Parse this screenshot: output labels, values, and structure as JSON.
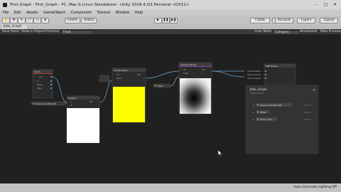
{
  "window": {
    "title": "First Graph - First_Graph - PC, Mac & Linux Standalone - Unity 2018.4.1f1 Personal <DX11>",
    "controls": [
      "–",
      "□",
      "✕"
    ]
  },
  "menu": [
    "File",
    "Edit",
    "Assets",
    "GameObject",
    "Component",
    "Tutorial",
    "Window",
    "Help"
  ],
  "toolbar": {
    "pivot_label": "Center",
    "space_label": "Global",
    "collab_label": "Collab",
    "account_label": "Account",
    "layers_label": "Layers",
    "layout_label": "Layout"
  },
  "tab": {
    "label": "Jello_Graph"
  },
  "graph_toolbar": {
    "save_label": "Save Asset",
    "show_project_label": "Show in Project",
    "precision_label": "Precision",
    "precision_value": "Float",
    "color_mode_label": "Color Mode",
    "color_mode_value": "Category",
    "blackboard_label": "Blackboard",
    "main_preview_label": "Main Preview"
  },
  "blackboard": {
    "title": "Jello_Graph",
    "subtitle": "Shader Graph",
    "properties": [
      {
        "name": "DisplacementStrength",
        "type": "Vector1"
      },
      {
        "name": "Offset",
        "type": "Vector1"
      },
      {
        "name": "Noise_Scale",
        "type": "Vector1"
      }
    ]
  },
  "nodes": {
    "left_node": {
      "title": "Vector",
      "ports": [
        "Out",
        "In",
        "Space",
        "Type"
      ]
    },
    "property_node": {
      "label": "DisplacementStrength"
    },
    "mult_node": {
      "title": "Multiply",
      "ports": [
        "A",
        "B",
        "Out"
      ]
    },
    "noise_node": {
      "title": "Simple Noise",
      "ports": [
        "UV",
        "Scale",
        "Out"
      ]
    },
    "yellow_node": {
      "title": "Simple Noise",
      "ports": [
        "UV",
        "Scale",
        "Out"
      ]
    },
    "offset_prop": {
      "label": "Offset"
    },
    "gradient_node": {
      "title": "Gradient Noise",
      "ports": [
        "UV",
        "Scale",
        "Out"
      ]
    },
    "noise_prop": {
      "label": "Noise_Scale"
    },
    "master": {
      "title": "PBR Master",
      "ports": [
        "Vertex Position",
        "Vertex Normal",
        "Vertex Tangent"
      ]
    }
  },
  "status": {
    "text": "Auto Generate Lighting Off"
  },
  "colors": {
    "canvas": "#202020",
    "node_body": "#2b2b2b",
    "node_header": "#3d3d3d",
    "yellow_preview": "#ffff00",
    "property_accent": "#8bc34a",
    "edge": "#6aa0c8",
    "master_header": "#8a4ab0"
  },
  "cursor": {
    "icon": "arrow-cursor-icon"
  }
}
